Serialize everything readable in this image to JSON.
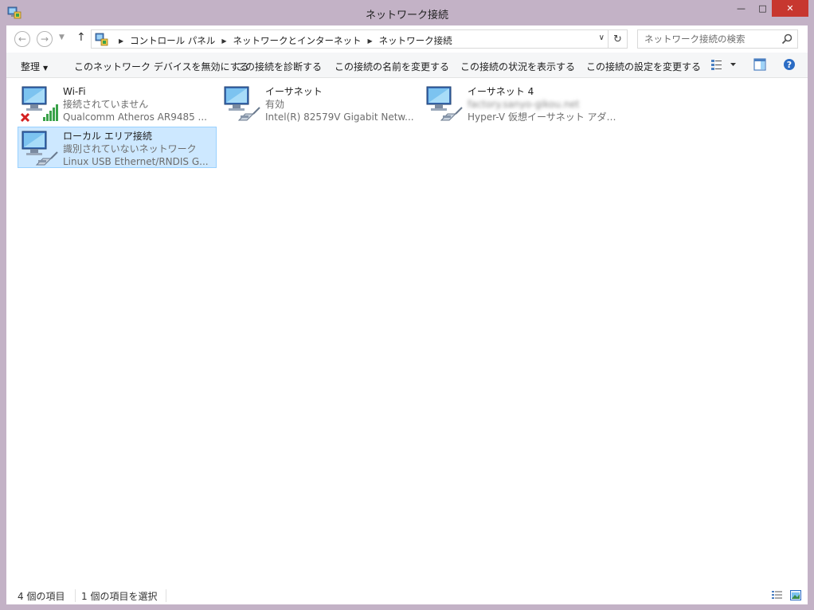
{
  "window": {
    "title": "ネットワーク接続",
    "minimize": "—",
    "maximize": "□",
    "close": "✕"
  },
  "address": {
    "crumbs": [
      "コントロール パネル",
      "ネットワークとインターネット",
      "ネットワーク接続"
    ],
    "search_placeholder": "ネットワーク接続の検索"
  },
  "commands": {
    "organize": "整理",
    "disable": "このネットワーク デバイスを無効にする",
    "diagnose": "この接続を診断する",
    "rename": "この接続の名前を変更する",
    "status": "この接続の状況を表示する",
    "settings": "この接続の設定を変更する"
  },
  "connections": [
    {
      "name": "Wi-Fi",
      "status": "接続されていません",
      "device": "Qualcomm Atheros AR9485 ...",
      "type": "wifi",
      "selected": false
    },
    {
      "name": "イーサネット",
      "status": "有効",
      "device": "Intel(R) 82579V Gigabit Netw...",
      "type": "ethernet",
      "selected": false
    },
    {
      "name": "イーサネット 4",
      "status": "factory.sanyo-gikou.net",
      "device": "Hyper-V 仮想イーサネット アダプタ...",
      "type": "ethernet",
      "selected": false
    },
    {
      "name": "ローカル エリア接続",
      "status": "識別されていないネットワーク",
      "device": "Linux USB Ethernet/RNDIS G...",
      "type": "ethernet",
      "selected": true
    }
  ],
  "statusbar": {
    "count": "4 個の項目",
    "selected": "1 個の項目を選択"
  },
  "colors": {
    "frame": "#c3b2c6",
    "selection": "#cde8ff",
    "close": "#c7372f"
  }
}
